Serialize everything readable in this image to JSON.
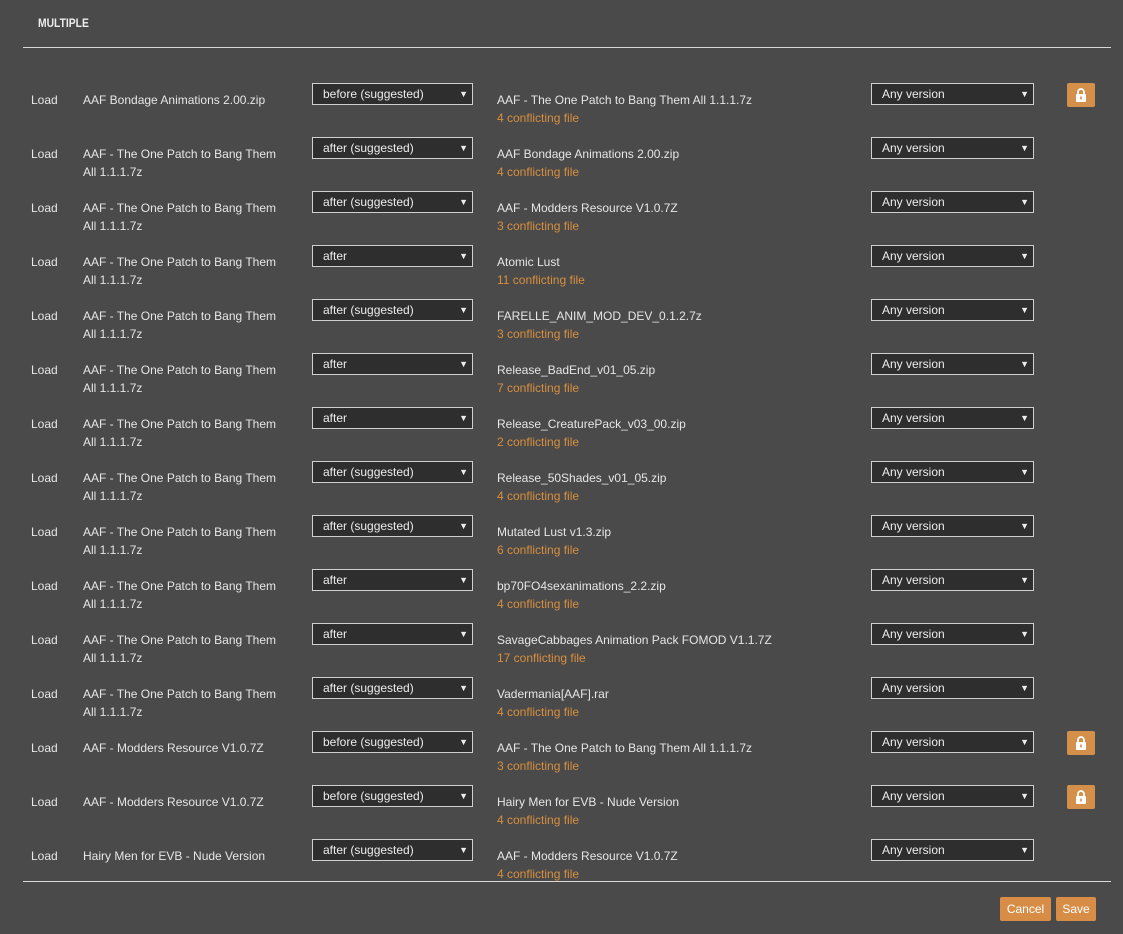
{
  "header": {
    "title": "MULTIPLE"
  },
  "rows": [
    {
      "load": "Load",
      "source": "AAF Bondage Animations 2.00.zip",
      "order": "before (suggested)",
      "target": "AAF - The One Patch to Bang Them All 1.1.1.7z",
      "conflicts": "4 conflicting file",
      "version": "Any version",
      "locked": true
    },
    {
      "load": "Load",
      "source": "AAF - The One Patch to Bang Them All 1.1.1.7z",
      "order": "after (suggested)",
      "target": "AAF Bondage Animations 2.00.zip",
      "conflicts": "4 conflicting file",
      "version": "Any version",
      "locked": false
    },
    {
      "load": "Load",
      "source": "AAF - The One Patch to Bang Them All 1.1.1.7z",
      "order": "after (suggested)",
      "target": "AAF - Modders Resource V1.0.7Z",
      "conflicts": "3 conflicting file",
      "version": "Any version",
      "locked": false
    },
    {
      "load": "Load",
      "source": "AAF - The One Patch to Bang Them All 1.1.1.7z",
      "order": "after",
      "target": "Atomic Lust",
      "conflicts": "11 conflicting file",
      "version": "Any version",
      "locked": false
    },
    {
      "load": "Load",
      "source": "AAF - The One Patch to Bang Them All 1.1.1.7z",
      "order": "after (suggested)",
      "target": "FARELLE_ANIM_MOD_DEV_0.1.2.7z",
      "conflicts": "3 conflicting file",
      "version": "Any version",
      "locked": false
    },
    {
      "load": "Load",
      "source": "AAF - The One Patch to Bang Them All 1.1.1.7z",
      "order": "after",
      "target": "Release_BadEnd_v01_05.zip",
      "conflicts": "7 conflicting file",
      "version": "Any version",
      "locked": false
    },
    {
      "load": "Load",
      "source": "AAF - The One Patch to Bang Them All 1.1.1.7z",
      "order": "after",
      "target": "Release_CreaturePack_v03_00.zip",
      "conflicts": "2 conflicting file",
      "version": "Any version",
      "locked": false
    },
    {
      "load": "Load",
      "source": "AAF - The One Patch to Bang Them All 1.1.1.7z",
      "order": "after (suggested)",
      "target": "Release_50Shades_v01_05.zip",
      "conflicts": "4 conflicting file",
      "version": "Any version",
      "locked": false
    },
    {
      "load": "Load",
      "source": "AAF - The One Patch to Bang Them All 1.1.1.7z",
      "order": "after (suggested)",
      "target": "Mutated Lust v1.3.zip",
      "conflicts": "6 conflicting file",
      "version": "Any version",
      "locked": false
    },
    {
      "load": "Load",
      "source": "AAF - The One Patch to Bang Them All 1.1.1.7z",
      "order": "after",
      "target": "bp70FO4sexanimations_2.2.zip",
      "conflicts": "4 conflicting file",
      "version": "Any version",
      "locked": false
    },
    {
      "load": "Load",
      "source": "AAF - The One Patch to Bang Them All 1.1.1.7z",
      "order": "after",
      "target": "SavageCabbages Animation Pack FOMOD V1.1.7Z",
      "conflicts": "17 conflicting file",
      "version": "Any version",
      "locked": false
    },
    {
      "load": "Load",
      "source": "AAF - The One Patch to Bang Them All 1.1.1.7z",
      "order": "after (suggested)",
      "target": "Vadermania[AAF].rar",
      "conflicts": "4 conflicting file",
      "version": "Any version",
      "locked": false
    },
    {
      "load": "Load",
      "source": "AAF - Modders Resource V1.0.7Z",
      "order": "before (suggested)",
      "target": "AAF - The One Patch to Bang Them All 1.1.1.7z",
      "conflicts": "3 conflicting file",
      "version": "Any version",
      "locked": true
    },
    {
      "load": "Load",
      "source": "AAF - Modders Resource V1.0.7Z",
      "order": "before (suggested)",
      "target": "Hairy Men for EVB - Nude Version",
      "conflicts": "4 conflicting file",
      "version": "Any version",
      "locked": true
    },
    {
      "load": "Load",
      "source": "Hairy Men for EVB - Nude Version",
      "order": "after (suggested)",
      "target": "AAF - Modders Resource V1.0.7Z",
      "conflicts": "4 conflicting file",
      "version": "Any version",
      "locked": false
    }
  ],
  "icons": {
    "caret": "caret-down-icon",
    "lock": "lock-icon"
  },
  "colors": {
    "background": "#4a4a4a",
    "accent": "#d88d47",
    "conflict_text": "#d88f3e"
  },
  "footer": {
    "cancel_label": "Cancel",
    "save_label": "Save"
  }
}
